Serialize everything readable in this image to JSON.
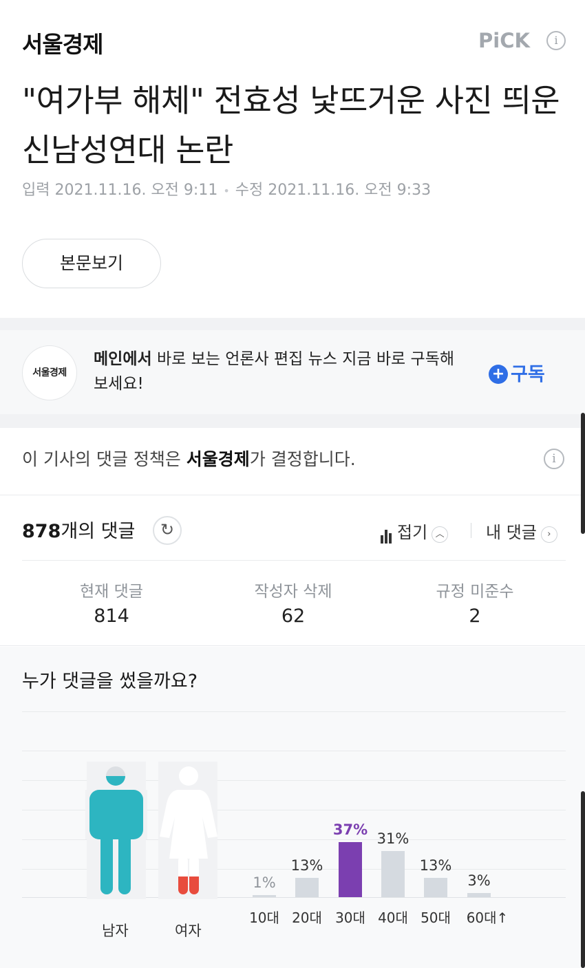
{
  "header": {
    "press_name": "서울경제",
    "pick_label": "PiCK",
    "info_glyph": "i"
  },
  "article": {
    "title": "\"여가부 해체\" 전효성 낯뜨거운 사진 띄운 신남성연대 논란",
    "input_label": "입력",
    "input_time": "2021.11.16. 오전 9:11",
    "edit_label": "수정",
    "edit_time": "2021.11.16. 오전 9:33",
    "view_body_label": "본문보기"
  },
  "subscribe": {
    "logo_text": "서울경제",
    "message_bold": "메인에서",
    "message_rest": " 바로 보는 언론사 편집 뉴스 지금 바로 구독해보세요!",
    "button_label": "구독",
    "accent_color": "#2f6ee6"
  },
  "comment_policy": {
    "prefix": "이 기사의 댓글 정책은 ",
    "press": "서울경제",
    "suffix": "가 결정합니다."
  },
  "comments": {
    "count": "878",
    "count_suffix": "개의 댓글",
    "fold_label": "접기",
    "my_comments_label": "내 댓글",
    "stats": [
      {
        "label": "현재 댓글",
        "value": "814"
      },
      {
        "label": "작성자 삭제",
        "value": "62"
      },
      {
        "label": "규정 미준수",
        "value": "2"
      }
    ]
  },
  "demographics": {
    "title": "누가 댓글을 썼을까요?",
    "gender": {
      "male_label": "남자",
      "female_label": "여자",
      "male_share": 0.9,
      "female_share": 0.1,
      "male_color": "#2db5c1",
      "female_color": "#e84c3d"
    },
    "chart_data": {
      "type": "bar",
      "categories": [
        "10대",
        "20대",
        "30대",
        "40대",
        "50대",
        "60대↑"
      ],
      "values": [
        1,
        13,
        37,
        31,
        13,
        3
      ],
      "labels": [
        "1%",
        "13%",
        "37%",
        "31%",
        "13%",
        "3%"
      ],
      "highlight_index": 2,
      "highlight_color": "#7b3fb0",
      "bar_color": "#d5dae0",
      "ylim": [
        0,
        37
      ]
    }
  }
}
